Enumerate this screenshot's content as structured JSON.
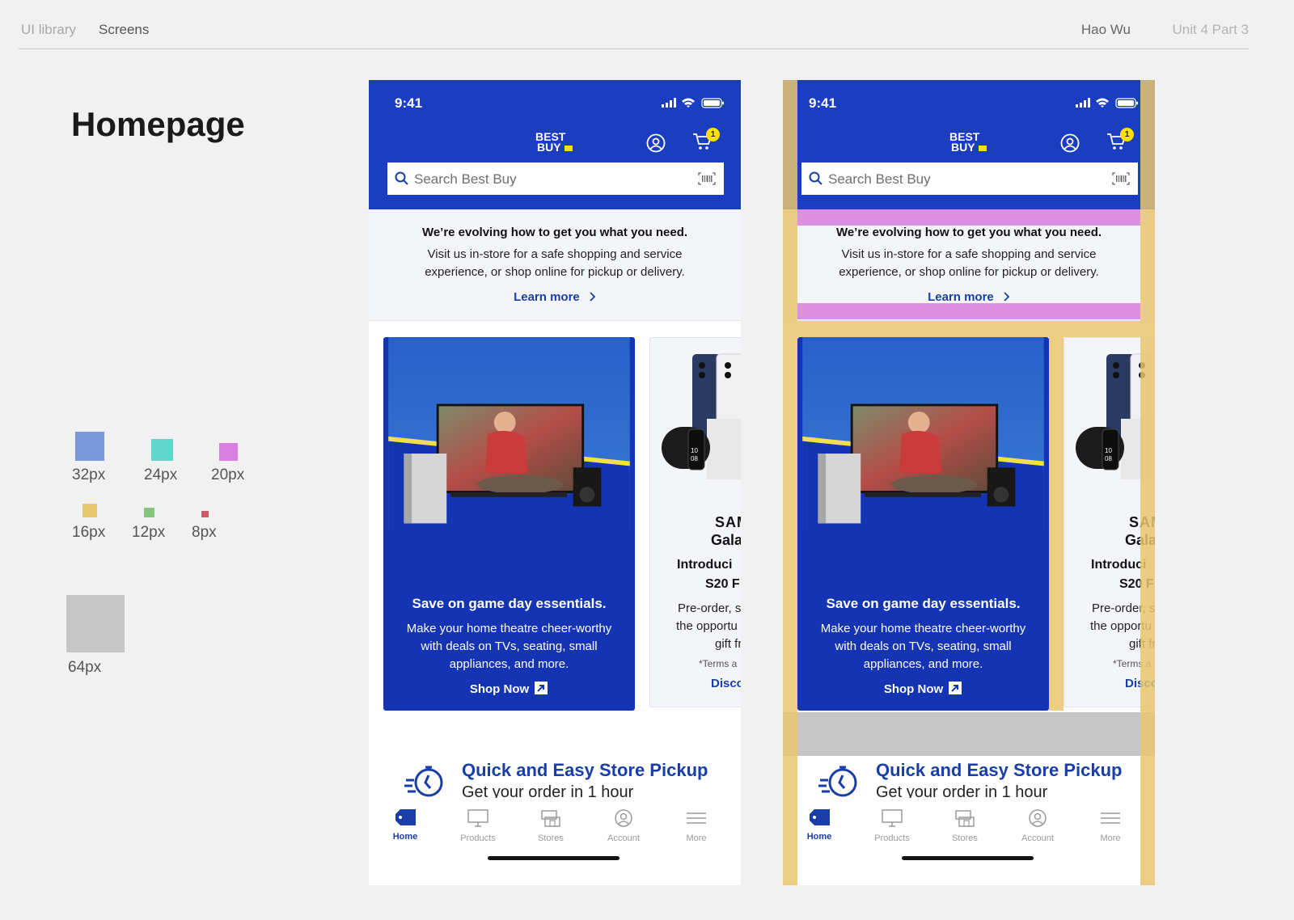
{
  "topbar": {
    "ui_library": "UI library",
    "screens": "Screens",
    "user": "Hao Wu",
    "unit": "Unit 4 Part 3"
  },
  "page_title": "Homepage",
  "legend": [
    {
      "label": "32px",
      "color": "#7b97dd"
    },
    {
      "label": "24px",
      "color": "#5fd6cc"
    },
    {
      "label": "20px",
      "color": "#d77ee0"
    },
    {
      "label": "16px",
      "color": "#e8c66f"
    },
    {
      "label": "12px",
      "color": "#86c47b"
    },
    {
      "label": "8px",
      "color": "#d05a6a"
    },
    {
      "label": "64px",
      "color": "#c6c6c6"
    }
  ],
  "phone": {
    "time": "9:41",
    "logo_line1": "BEST",
    "logo_line2": "BUY",
    "cart_count": "1",
    "search_placeholder": "Search Best Buy",
    "notice_heading": "We’re evolving how to get you what you need.",
    "notice_body": "Visit us in-store for a safe shopping and service experience, or shop online for pickup or delivery.",
    "learn_more": "Learn more",
    "card1": {
      "heading": "Save on game day essentials.",
      "body": "Make your home theatre cheer-worthy with deals on TVs, seating, small appliances, and more.",
      "cta": "Shop Now"
    },
    "card2": {
      "brand": "SAM",
      "galaxy": "Gala",
      "intro": "Introduci",
      "model": "S20 F",
      "pre": "Pre-order, s",
      "opp": "the opportu",
      "gift": "gift fr",
      "terms": "*Terms a",
      "disc": "Disco"
    },
    "pickup_heading": "Quick and Easy Store Pickup",
    "pickup_sub": "Get your order in 1 hour",
    "tabs": [
      "Home",
      "Products",
      "Stores",
      "Account",
      "More"
    ],
    "colors": {
      "brand_blue": "#1b3ec1",
      "card_blue": "#1434b4",
      "link_blue": "#1a3ea9",
      "brand_yellow": "#ffe000"
    }
  }
}
